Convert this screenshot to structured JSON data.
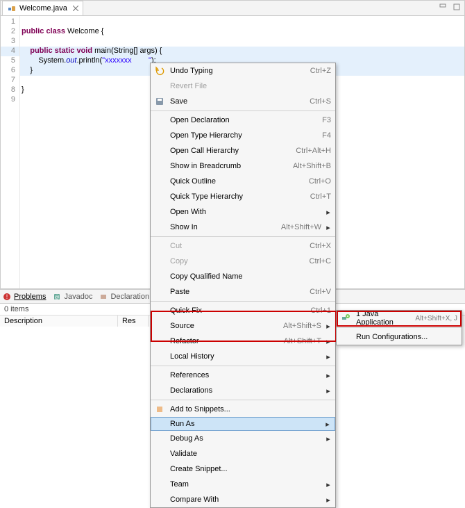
{
  "tab": {
    "filename": "Welcome.java"
  },
  "code": {
    "l2": {
      "kw": "public class",
      "name": " Welcome {"
    },
    "l4": {
      "kw": "    public static void",
      "sig": " main(String[] args) {"
    },
    "l5a": "        System.",
    "l5b": "out",
    "l5c": ".println(",
    "l5d": "\"xxxxxxx        \"",
    "l5e": ");",
    "l6": "    }",
    "l8": "}"
  },
  "menu": {
    "undo": "Undo Typing",
    "undo_sc": "Ctrl+Z",
    "revert": "Revert File",
    "save": "Save",
    "save_sc": "Ctrl+S",
    "opendecl": "Open Declaration",
    "opendecl_sc": "F3",
    "openth": "Open Type Hierarchy",
    "openth_sc": "F4",
    "opencall": "Open Call Hierarchy",
    "opencall_sc": "Ctrl+Alt+H",
    "breadcrumb": "Show in Breadcrumb",
    "breadcrumb_sc": "Alt+Shift+B",
    "quickoutline": "Quick Outline",
    "quickoutline_sc": "Ctrl+O",
    "quicktype": "Quick Type Hierarchy",
    "quicktype_sc": "Ctrl+T",
    "openwith": "Open With",
    "showin": "Show In",
    "showin_sc": "Alt+Shift+W",
    "cut": "Cut",
    "cut_sc": "Ctrl+X",
    "copy": "Copy",
    "copy_sc": "Ctrl+C",
    "copyqn": "Copy Qualified Name",
    "paste": "Paste",
    "paste_sc": "Ctrl+V",
    "quickfix": "Quick Fix",
    "quickfix_sc": "Ctrl+1",
    "source": "Source",
    "source_sc": "Alt+Shift+S",
    "refactor": "Refactor",
    "refactor_sc": "Alt+Shift+T",
    "localhist": "Local History",
    "refs": "References",
    "decls": "Declarations",
    "snippets": "Add to Snippets...",
    "runas": "Run As",
    "debugas": "Debug As",
    "validate": "Validate",
    "createsnip": "Create Snippet...",
    "team": "Team",
    "compare": "Compare With"
  },
  "submenu": {
    "javaapp": "1 Java Application",
    "javaapp_sc": "Alt+Shift+X, J",
    "runconf": "Run Configurations..."
  },
  "bottom": {
    "problems": "Problems",
    "javadoc": "Javadoc",
    "decl": "Declaration",
    "count": "0 items",
    "h_desc": "Description",
    "h_res": "Res"
  }
}
